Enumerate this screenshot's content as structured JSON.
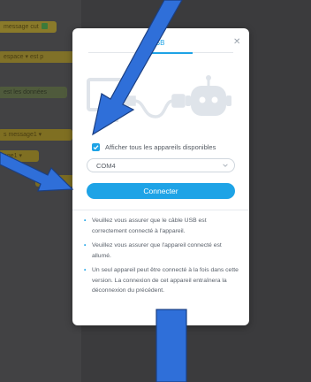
{
  "background": {
    "blocks": [
      {
        "label": "message cut"
      },
      {
        "label": "espace ▾  est p"
      },
      {
        "label": "est les données"
      },
      {
        "label": "s  message1 ▾"
      },
      {
        "label": "age1 ▾"
      },
      {
        "label": "ment"
      }
    ]
  },
  "modal": {
    "tab_label": "USB",
    "close_icon": "close-icon",
    "illustration": [
      "monitor-icon",
      "usb-cable-icon",
      "robot-icon"
    ],
    "checkbox": {
      "checked": true,
      "label": "Afficher tous les appareils disponibles"
    },
    "port_select": {
      "value": "COM4"
    },
    "connect_label": "Connecter",
    "notes": [
      "Veuillez vous assurer que le câble USB est correctement connecté à l'appareil.",
      "Veuillez vous assurer que l'appareil connecté est allumé.",
      "Un seul appareil peut être connecté à la fois dans cette version. La connexion de cet appareil entraînera la déconnexion du précédent."
    ]
  },
  "colors": {
    "accent": "#1ea3e6",
    "annotation_arrow": "#2f6fd9"
  }
}
